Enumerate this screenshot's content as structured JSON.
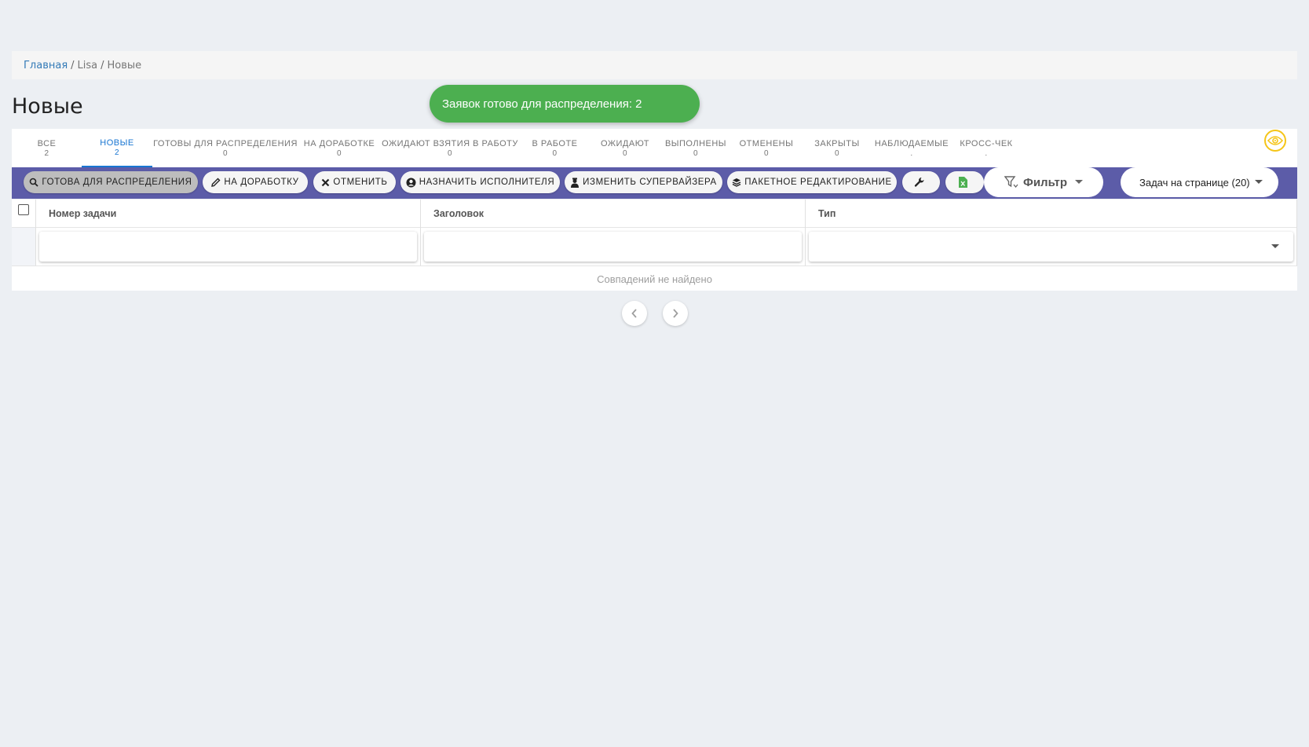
{
  "breadcrumb": {
    "home": "Главная",
    "section": "Lisa",
    "current": "Новые",
    "separator": "/"
  },
  "page_title": "Новые",
  "toast": {
    "message": "Заявок готово для распределения: 2",
    "color": "#4caf50"
  },
  "tabs": [
    {
      "label": "Все",
      "count": "2"
    },
    {
      "label": "Новые",
      "count": "2"
    },
    {
      "label": "Готовы для распределения",
      "count": "0"
    },
    {
      "label": "На доработке",
      "count": "0"
    },
    {
      "label": "Ожидают взятия в работу",
      "count": "0"
    },
    {
      "label": "В работе",
      "count": "0"
    },
    {
      "label": "Ожидают",
      "count": "0"
    },
    {
      "label": "Выполнены",
      "count": "0"
    },
    {
      "label": "Отменены",
      "count": "0"
    },
    {
      "label": "Закрыты",
      "count": "0"
    },
    {
      "label": "Наблюдаемые",
      "count": "."
    },
    {
      "label": "Кросс-чек",
      "count": "."
    }
  ],
  "active_tab": "Новые",
  "toolbar": {
    "ready_label": "Готова для распределения",
    "rework_label": "На доработку",
    "cancel_label": "Отменить",
    "assign_label": "Назначить исполнителя",
    "supervisor_label": "Изменить супервайзера",
    "batch_label": "Пакетное редактирование",
    "filter_label": "Фильтр",
    "per_page_label": "Задач на странице (20)",
    "background": "#5c5ca8"
  },
  "grid": {
    "columns": [
      "Номер задачи",
      "Заголовок",
      "Тип"
    ],
    "empty_message": "Совпадений не найдено"
  },
  "colors": {
    "accent": "#1976d2",
    "link": "#337ab7",
    "excel": "#4caf50",
    "eye": "#f5c518"
  }
}
